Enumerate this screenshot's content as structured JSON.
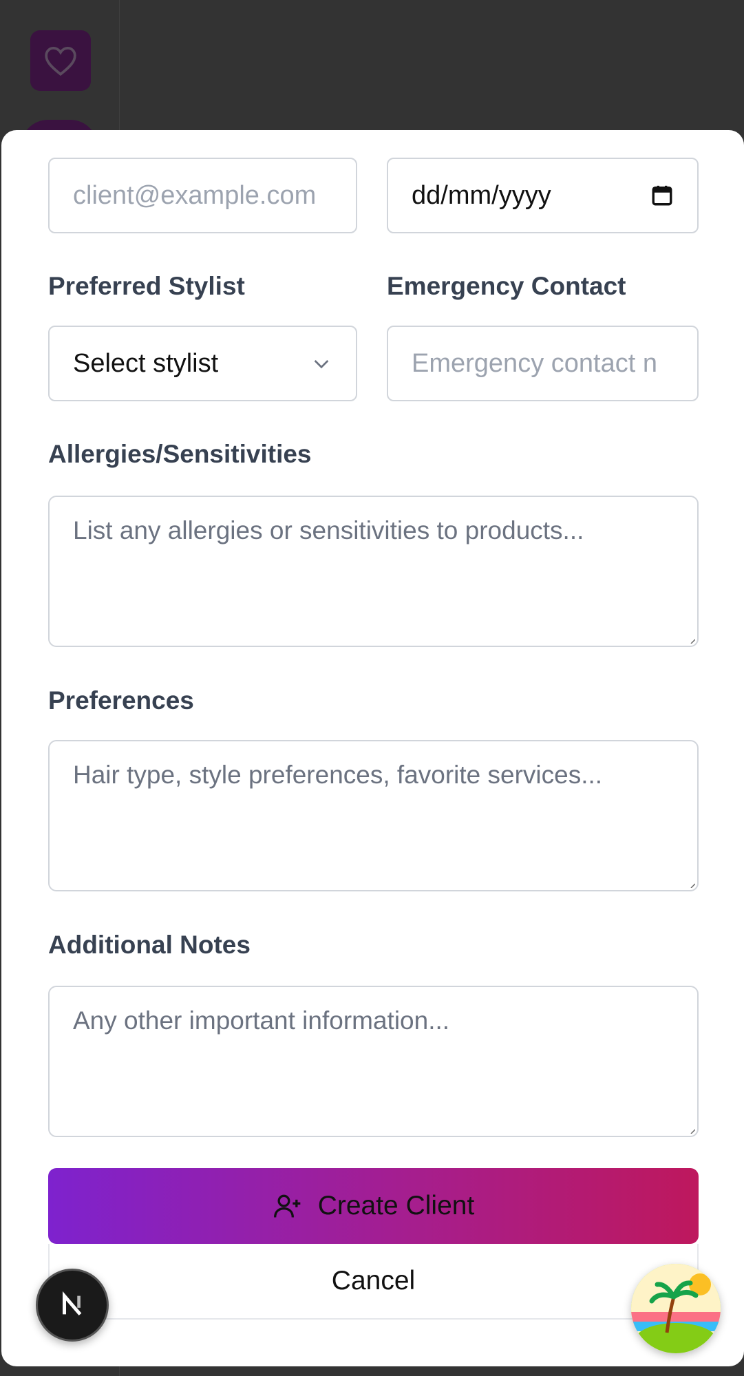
{
  "form": {
    "email_placeholder": "client@example.com",
    "dob_placeholder": "dd/mm/yyyy",
    "stylist_label": "Preferred Stylist",
    "stylist_value": "Select stylist",
    "emergency_label": "Emergency Contact",
    "emergency_placeholder": "Emergency contact n",
    "allergies_label": "Allergies/Sensitivities",
    "allergies_placeholder": "List any allergies or sensitivities to products...",
    "preferences_label": "Preferences",
    "preferences_placeholder": "Hair type, style preferences, favorite services...",
    "notes_label": "Additional Notes",
    "notes_placeholder": "Any other important information..."
  },
  "actions": {
    "create_label": "Create Client",
    "cancel_label": "Cancel"
  },
  "colors": {
    "gradient_start": "#7e22ce",
    "gradient_end": "#be185d",
    "backdrop": "#333333"
  },
  "icons": {
    "backdrop_logo": "heart-icon",
    "calendar": "calendar-icon",
    "dropdown": "chevron-down-icon",
    "create": "user-plus-icon",
    "dev_badge": "nextjs-icon",
    "floating_badge": "island-icon"
  }
}
